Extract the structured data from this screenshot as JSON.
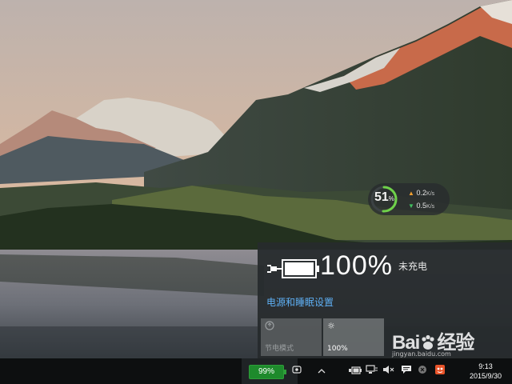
{
  "monitor": {
    "cpu_value": "51",
    "cpu_unit": "%",
    "cpu_fraction": 0.51,
    "upload_value": "0.2",
    "upload_unit": "K/s",
    "download_value": "0.5",
    "download_unit": "K/s"
  },
  "flyout": {
    "battery_percent": "100%",
    "battery_fraction": 1.0,
    "charge_status": "未充电",
    "power_settings_link": "电源和睡眠设置",
    "tiles": [
      {
        "icon": "battery-saver-icon",
        "label": "节电模式"
      },
      {
        "icon": "brightness-icon",
        "label": "100%"
      }
    ]
  },
  "taskbar": {
    "battery_pill": "99%",
    "battery_pill_fraction": 0.99,
    "clock_time": "9:13",
    "clock_date": "2015/9/30"
  },
  "watermark": {
    "logo_text_a": "Bai",
    "logo_text_b": "经验",
    "site": "jingyan.baidu.com"
  },
  "colors": {
    "accent_link": "#5fb0f5",
    "battery_green": "#1e8a2c",
    "flyout_bg": "#262a2d"
  }
}
